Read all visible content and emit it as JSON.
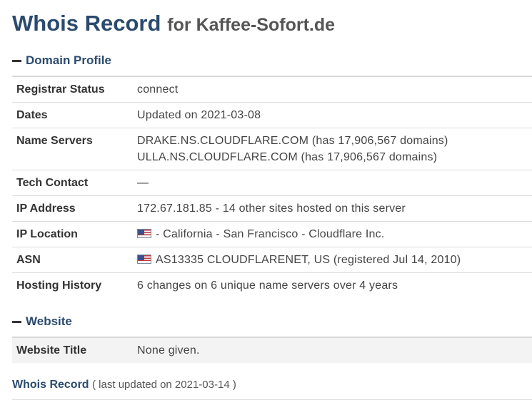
{
  "title": {
    "main": "Whois Record",
    "for": "for Kaffee-Sofort.de"
  },
  "domain_profile": {
    "heading": "Domain Profile",
    "rows": [
      {
        "label": "Registrar Status",
        "value": "connect"
      },
      {
        "label": "Dates",
        "value": "Updated on 2021-03-08"
      },
      {
        "label": "Name Servers",
        "value_line1": "DRAKE.NS.CLOUDFLARE.COM (has 17,906,567 domains)",
        "value_line2": "ULLA.NS.CLOUDFLARE.COM (has 17,906,567 domains)"
      },
      {
        "label": "Tech Contact",
        "value": "—"
      },
      {
        "label": "IP Address",
        "value": "172.67.181.85 - 14 other sites hosted on this server"
      },
      {
        "label": "IP Location",
        "value": "- California - San Francisco - Cloudflare Inc.",
        "icon": "us-flag-icon"
      },
      {
        "label": "ASN",
        "value": "AS13335 CLOUDFLARENET, US (registered Jul 14, 2010)",
        "icon": "us-flag-icon"
      },
      {
        "label": "Hosting History",
        "value": "6 changes on 6 unique name servers over 4 years"
      }
    ]
  },
  "website": {
    "heading": "Website",
    "rows": [
      {
        "label": "Website Title",
        "value": "None given."
      }
    ]
  },
  "footer": {
    "link": "Whois Record",
    "note": "( last updated on 2021-03-14 )"
  },
  "colors": {
    "heading_blue": "#2b4a6e",
    "text": "#333333",
    "row_border": "#dddddd",
    "website_row_bg": "#f3f3f3"
  }
}
